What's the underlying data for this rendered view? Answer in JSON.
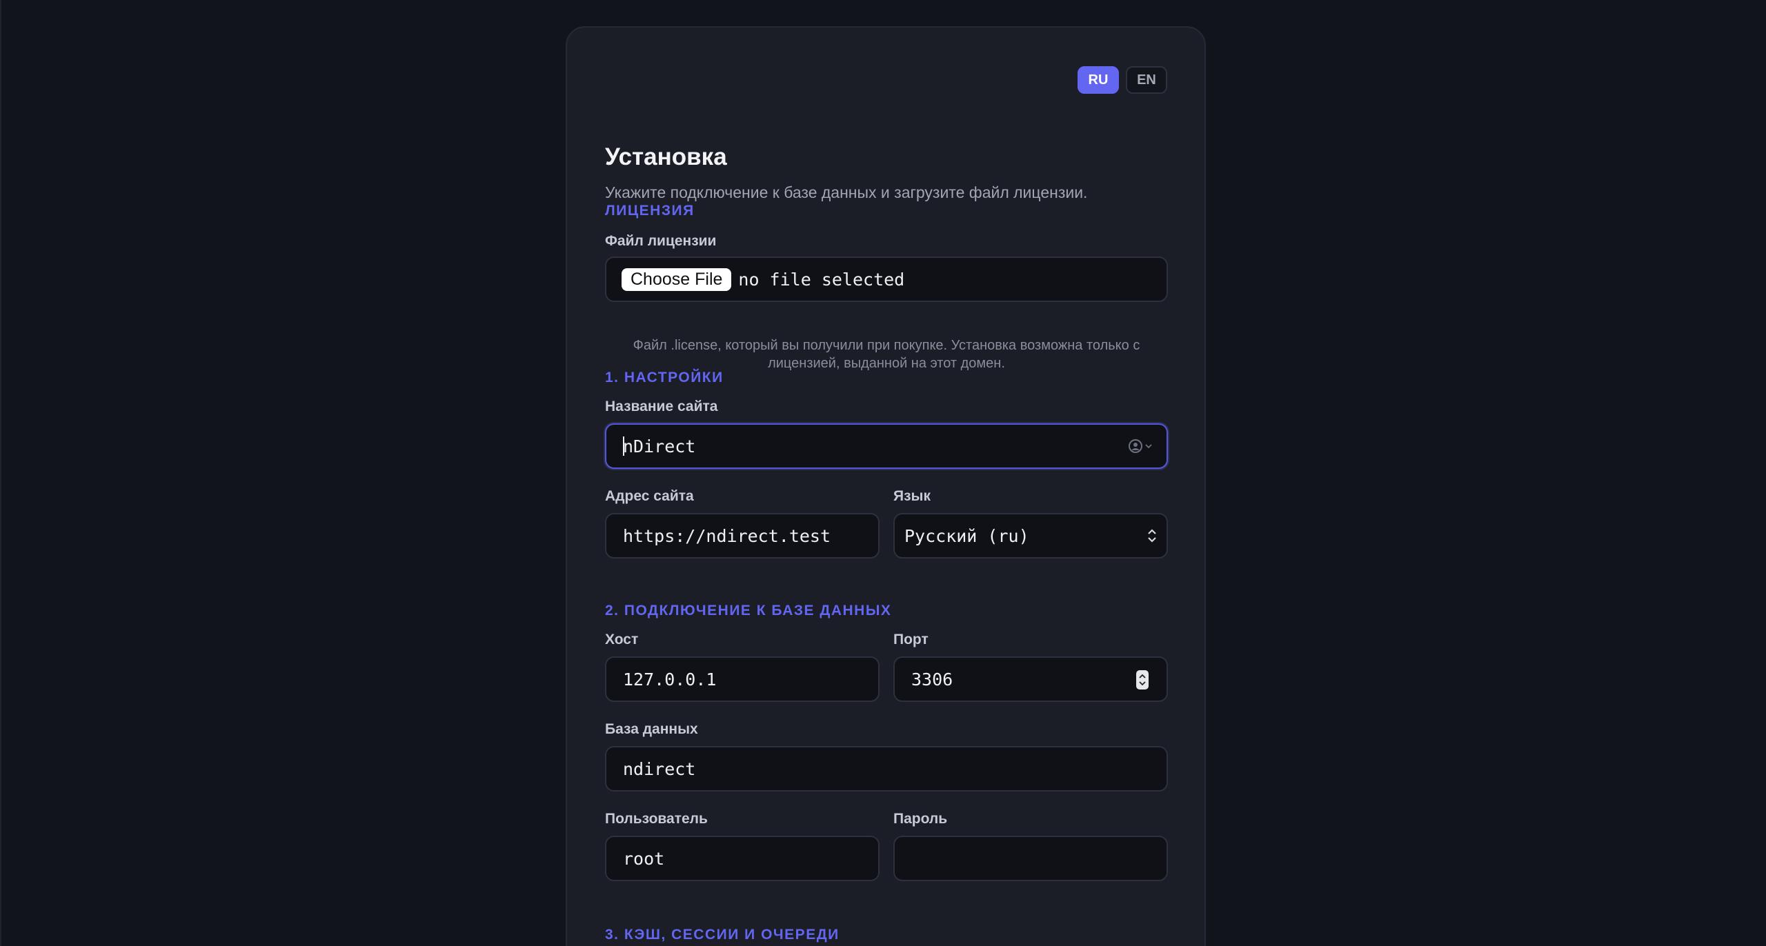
{
  "lang_switch": {
    "ru": "RU",
    "en": "EN"
  },
  "header": {
    "title": "Установка",
    "subtitle": "Укажите подключение к базе данных и загрузите файл лицензии."
  },
  "license": {
    "section_title": "ЛИЦЕНЗИЯ",
    "file_label": "Файл лицензии",
    "choose_button": "Choose File",
    "file_status": "no file selected",
    "hint": "Файл .license, который вы получили при покупке. Установка возможна только с лицензией, выданной на этот домен."
  },
  "settings": {
    "section_title": "1. НАСТРОЙКИ",
    "site_name_label": "Название сайта",
    "site_name_value": "nDirect",
    "site_url_label": "Адрес сайта",
    "site_url_value": "https://ndirect.test",
    "language_label": "Язык",
    "language_value": "Русский (ru)"
  },
  "database": {
    "section_title": "2. ПОДКЛЮЧЕНИЕ К БАЗЕ ДАННЫХ",
    "host_label": "Хост",
    "host_value": "127.0.0.1",
    "port_label": "Порт",
    "port_value": "3306",
    "db_label": "База данных",
    "db_value": "ndirect",
    "user_label": "Пользователь",
    "user_value": "root",
    "password_label": "Пароль",
    "password_value": ""
  },
  "cache": {
    "section_title": "3. КЭШ, СЕССИИ И ОЧЕРЕДИ"
  },
  "colors": {
    "accent": "#6366f1",
    "background": "#12141b",
    "card": "#1b1d27"
  },
  "icons": {
    "autofill": "contact-autofill-icon",
    "select": "select-arrows-icon",
    "spinner": "number-spinner-icon"
  }
}
